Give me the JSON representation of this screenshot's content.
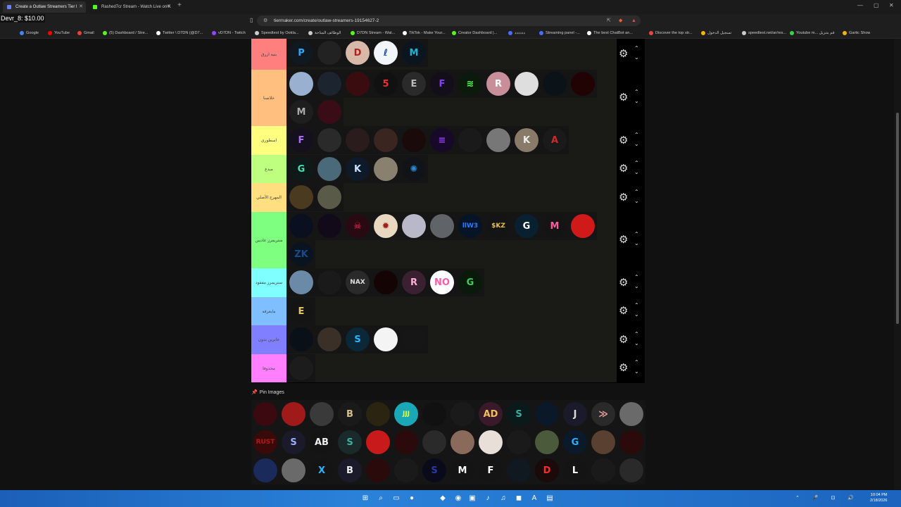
{
  "overlay": {
    "text": "Devr_8: $10.00"
  },
  "browser": {
    "tabs": [
      {
        "label": "Create a Outlaw Streamers Tier l",
        "active": true,
        "favicon_color": "#6b7dff"
      },
      {
        "label": "Rashed7cr Stream - Watch Live on K",
        "active": false,
        "favicon_color": "#53fc18"
      }
    ],
    "new_tab": "+",
    "window_controls": [
      "—",
      "▢",
      "✕"
    ],
    "url": "tiermaker.com/create/outlaw-streamers-19154627-2",
    "bookmarks": [
      {
        "label": "Google",
        "color": "#4285f4"
      },
      {
        "label": "YouTube",
        "color": "#ff0000"
      },
      {
        "label": "Gmail",
        "color": "#ea4335"
      },
      {
        "label": "(5) Dashboard / Stre...",
        "color": "#53fc18"
      },
      {
        "label": "Twitter \\ D7DN (@D7...",
        "color": "#ffffff"
      },
      {
        "label": "vD7DN - Twitch",
        "color": "#9146ff"
      },
      {
        "label": "Speedtest by Ookla...",
        "color": "#cccccc"
      },
      {
        "label": "الوظائف المتاحة",
        "color": "#cccccc"
      },
      {
        "label": "D7DN Stream - Wat...",
        "color": "#53fc18"
      },
      {
        "label": "TikTok - Make Your...",
        "color": "#ffffff"
      },
      {
        "label": "Creator Dashboard |...",
        "color": "#53fc18"
      },
      {
        "label": "دددددد",
        "color": "#4b6bff"
      },
      {
        "label": "Streaming panel -...",
        "color": "#4b6bff"
      },
      {
        "label": "The best ChatBot an...",
        "color": "#ffffff"
      },
      {
        "label": "Discover the top str...",
        "color": "#e84545"
      },
      {
        "label": "تسجيل الدخول",
        "color": "#f5b400"
      },
      {
        "label": "speedtest.net/ar/res...",
        "color": "#cccccc"
      },
      {
        "label": "Youtube m... قم بتنزيل",
        "color": "#3ecf4a"
      },
      {
        "label": "Gartic Show",
        "color": "#f5b400"
      }
    ]
  },
  "tiers": [
    {
      "label": "بنيه ازرق",
      "color": "#ff7f7f",
      "items": [
        {
          "glyph": "P",
          "bg": "#101820",
          "fg": "#2ea8ff"
        },
        {
          "glyph": "",
          "bg": "#222",
          "fg": "#888"
        },
        {
          "glyph": "D",
          "bg": "#d8b8a8",
          "fg": "#b0201c"
        },
        {
          "glyph": "ℓ",
          "bg": "#f2f6fa",
          "fg": "#1a4aa8"
        },
        {
          "glyph": "M",
          "bg": "#0a1520",
          "fg": "#19b3d4"
        }
      ]
    },
    {
      "label": "خلاصنا",
      "color": "#ffbf7f",
      "items": [
        {
          "glyph": "",
          "bg": "#9ab0d0",
          "fg": "#fff"
        },
        {
          "glyph": "",
          "bg": "#1c2430",
          "fg": "#555"
        },
        {
          "glyph": "",
          "bg": "#3a0c10",
          "fg": "#c01a1a"
        },
        {
          "glyph": "5",
          "bg": "#111",
          "fg": "#ff2b2b"
        },
        {
          "glyph": "E",
          "bg": "#2a2a2a",
          "fg": "#bbb"
        },
        {
          "glyph": "F",
          "bg": "#120f1a",
          "fg": "#8a3cff"
        },
        {
          "glyph": "≋",
          "bg": "#0b1a0b",
          "fg": "#55ff55"
        },
        {
          "glyph": "R",
          "bg": "#c88e9a",
          "fg": "#fff"
        },
        {
          "glyph": "",
          "bg": "#dedede",
          "fg": "#222"
        },
        {
          "glyph": "",
          "bg": "#0b1218",
          "fg": "#29b6d8"
        },
        {
          "glyph": "",
          "bg": "#220303",
          "fg": "#d01a1a"
        },
        {
          "glyph": "M",
          "bg": "#1e1e1e",
          "fg": "#aaa"
        },
        {
          "glyph": "",
          "bg": "#3a0c16",
          "fg": "#c02050"
        }
      ]
    },
    {
      "label": "اسطوري",
      "color": "#ffff7f",
      "items": [
        {
          "glyph": "F",
          "bg": "#14101e",
          "fg": "#b070ff"
        },
        {
          "glyph": "",
          "bg": "#2a2a2a",
          "fg": "#ddd"
        },
        {
          "glyph": "",
          "bg": "#2a1c1c",
          "fg": "#c44"
        },
        {
          "glyph": "",
          "bg": "#3a2520",
          "fg": "#caa"
        },
        {
          "glyph": "",
          "bg": "#1a0a0a",
          "fg": "#d33"
        },
        {
          "glyph": "≡",
          "bg": "#18082a",
          "fg": "#9a3cff"
        },
        {
          "glyph": "",
          "bg": "#1a1a1a",
          "fg": "#999"
        },
        {
          "glyph": "",
          "bg": "#777",
          "fg": "#eee"
        },
        {
          "glyph": "K",
          "bg": "#8a7a68",
          "fg": "#eee"
        },
        {
          "glyph": "A",
          "bg": "#1a1a1a",
          "fg": "#d02a2a"
        }
      ]
    },
    {
      "label": "مبدع",
      "color": "#bfff7f",
      "items": [
        {
          "glyph": "G",
          "bg": "#0d1a17",
          "fg": "#3fe0b0"
        },
        {
          "glyph": "",
          "bg": "#4a6a7a",
          "fg": "#eee"
        },
        {
          "glyph": "K",
          "bg": "#0e1a2a",
          "fg": "#cfe0ff"
        },
        {
          "glyph": "",
          "bg": "#8a8070",
          "fg": "#eee"
        },
        {
          "glyph": "✺",
          "bg": "#101418",
          "fg": "#2a8ad8"
        }
      ]
    },
    {
      "label": "المهرج الأصلي",
      "color": "#ffdf7f",
      "items": [
        {
          "glyph": "",
          "bg": "#4a3a20",
          "fg": "#d8b050"
        },
        {
          "glyph": "",
          "bg": "#5a5a48",
          "fg": "#ddd"
        }
      ]
    },
    {
      "label": "ستريمرز عاديين",
      "color": "#7fff7f",
      "items": [
        {
          "glyph": "",
          "bg": "#0a1020",
          "fg": "#2a6ad8"
        },
        {
          "glyph": "",
          "bg": "#120a18",
          "fg": "#c060ff"
        },
        {
          "glyph": "☠",
          "bg": "#2a0a12",
          "fg": "#ff2a5a"
        },
        {
          "glyph": "✹",
          "bg": "#e8d8c0",
          "fg": "#a0201a"
        },
        {
          "glyph": "",
          "bg": "#b8b8c8",
          "fg": "#333"
        },
        {
          "glyph": "",
          "bg": "#606468",
          "fg": "#ccc"
        },
        {
          "glyph": "llW3",
          "bg": "#061428",
          "fg": "#2a7aff"
        },
        {
          "glyph": "$KZ",
          "bg": "#141414",
          "fg": "#e8c040"
        },
        {
          "glyph": "G",
          "bg": "#082030",
          "fg": "#fff"
        },
        {
          "glyph": "M",
          "bg": "#141414",
          "fg": "#ff5aa0"
        },
        {
          "glyph": "",
          "bg": "#d01a1a",
          "fg": "#111"
        },
        {
          "glyph": "ZK",
          "bg": "#0a1420",
          "fg": "#1a4a8a"
        }
      ]
    },
    {
      "label": "ستريمرز مفقود",
      "color": "#7fffff",
      "items": [
        {
          "glyph": "",
          "bg": "#6a8aa8",
          "fg": "#eee"
        },
        {
          "glyph": "",
          "bg": "#1a1a1a",
          "fg": "#777"
        },
        {
          "glyph": "NAX",
          "bg": "#2a2a2a",
          "fg": "#ddd"
        },
        {
          "glyph": "",
          "bg": "#140404",
          "fg": "#e01a1a"
        },
        {
          "glyph": "R",
          "bg": "#3a2030",
          "fg": "#ffb0d8"
        },
        {
          "glyph": "NO",
          "bg": "#ffffff",
          "fg": "#ff5aa8"
        },
        {
          "glyph": "G",
          "bg": "#0a1a0a",
          "fg": "#3acf5a"
        }
      ]
    },
    {
      "label": "مايعرفه",
      "color": "#7fbfff",
      "items": [
        {
          "glyph": "E",
          "bg": "#141414",
          "fg": "#e8c860"
        }
      ]
    },
    {
      "label": "عابرين بدون",
      "color": "#7f7fff",
      "items": [
        {
          "glyph": "",
          "bg": "#0a1018",
          "fg": "#1a4a8a"
        },
        {
          "glyph": "",
          "bg": "#3a3028",
          "fg": "#ddd"
        },
        {
          "glyph": "S",
          "bg": "#0a2838",
          "fg": "#2ab4ff"
        },
        {
          "glyph": "",
          "bg": "#f4f4f4",
          "fg": "#1a2a6a"
        },
        {
          "glyph": "",
          "bg": "#161616",
          "fg": "#444"
        }
      ]
    },
    {
      "label": "محذوفا",
      "color": "#ff7fff",
      "items": [
        {
          "glyph": "",
          "bg": "#1c1c1c",
          "fg": "#555"
        }
      ]
    }
  ],
  "pin_images": {
    "title": "Pin Images",
    "items": [
      {
        "glyph": "",
        "bg": "#3a0a10",
        "fg": "#ff2a3a"
      },
      {
        "glyph": "",
        "bg": "#a01a1a",
        "fg": "#111"
      },
      {
        "glyph": "",
        "bg": "#3a3a3a",
        "fg": "#ccc"
      },
      {
        "glyph": "B",
        "bg": "#1a1a1a",
        "fg": "#d8c08a"
      },
      {
        "glyph": "",
        "bg": "#2a2410",
        "fg": "#e8d040"
      },
      {
        "glyph": "JJJ",
        "bg": "#1aa8b8",
        "fg": "#e8ff3a"
      },
      {
        "glyph": "",
        "bg": "#111",
        "fg": "#777"
      },
      {
        "glyph": "",
        "bg": "#1a1a1a",
        "fg": "#d02a2a"
      },
      {
        "glyph": "AD",
        "bg": "#3a1a2a",
        "fg": "#f0c060"
      },
      {
        "glyph": "S",
        "bg": "#0a1a1a",
        "fg": "#3ab0a0"
      },
      {
        "glyph": "",
        "bg": "#0a1828",
        "fg": "#1a6ad8"
      },
      {
        "glyph": "J",
        "bg": "#1a1a2a",
        "fg": "#ddd"
      },
      {
        "glyph": "≫",
        "bg": "#2a2a2a",
        "fg": "#e8a0a0"
      },
      {
        "glyph": "",
        "bg": "#6a6a6a",
        "fg": "#eee"
      },
      {
        "glyph": "RUST",
        "bg": "#3a0a0a",
        "fg": "#b01a1a"
      },
      {
        "glyph": "S",
        "bg": "#1a1a2a",
        "fg": "#9ab0ff"
      },
      {
        "glyph": "AB",
        "bg": "#141414",
        "fg": "#eee"
      },
      {
        "glyph": "S",
        "bg": "#1a2a2a",
        "fg": "#3ab0a0"
      },
      {
        "glyph": "",
        "bg": "#c81a1a",
        "fg": "#111"
      },
      {
        "glyph": "",
        "bg": "#2a0a0a",
        "fg": "#d02a2a"
      },
      {
        "glyph": "",
        "bg": "#2a2a2a",
        "fg": "#ccc"
      },
      {
        "glyph": "",
        "bg": "#8a6a5a",
        "fg": "#eee"
      },
      {
        "glyph": "",
        "bg": "#e8e0d8",
        "fg": "#333"
      },
      {
        "glyph": "",
        "bg": "#1a1a1a",
        "fg": "#eee"
      },
      {
        "glyph": "",
        "bg": "#4a5a3a",
        "fg": "#eee"
      },
      {
        "glyph": "G",
        "bg": "#0a1a2a",
        "fg": "#2ab0ff"
      },
      {
        "glyph": "",
        "bg": "#5a4030",
        "fg": "#eee"
      },
      {
        "glyph": "",
        "bg": "#2a0a0a",
        "fg": "#ff6a2a"
      },
      {
        "glyph": "",
        "bg": "#1a2a5a",
        "fg": "#8ab0ff"
      },
      {
        "glyph": "",
        "bg": "#6a6a6a",
        "fg": "#eee"
      },
      {
        "glyph": "X",
        "bg": "#141414",
        "fg": "#2ab4ff"
      },
      {
        "glyph": "B",
        "bg": "#1a1a2a",
        "fg": "#eee"
      },
      {
        "glyph": "",
        "bg": "#2a0a0a",
        "fg": "#ff2a3a"
      },
      {
        "glyph": "",
        "bg": "#1a1a1a",
        "fg": "#ddd"
      },
      {
        "glyph": "S",
        "bg": "#0a0a1a",
        "fg": "#2a3aa8"
      },
      {
        "glyph": "M",
        "bg": "#141414",
        "fg": "#fff"
      },
      {
        "glyph": "F",
        "bg": "#141414",
        "fg": "#fff"
      },
      {
        "glyph": "",
        "bg": "#101820",
        "fg": "#9ab0d0"
      },
      {
        "glyph": "D",
        "bg": "#1a0a0a",
        "fg": "#ff2a2a"
      },
      {
        "glyph": "L",
        "bg": "#141414",
        "fg": "#fff"
      },
      {
        "glyph": "",
        "bg": "#1a1a1a",
        "fg": "#aaa"
      },
      {
        "glyph": "",
        "bg": "#2a2a2a",
        "fg": "#888"
      }
    ]
  },
  "controls": {
    "gear": "⚙",
    "up": "⌃",
    "down": "⌄"
  },
  "taskbar": {
    "icons": [
      "⊞",
      "⌕",
      "▭",
      "●",
      "◆",
      "◉",
      "▣",
      "♪",
      "♫",
      "◼",
      "A",
      "▤",
      "◎"
    ],
    "tray": "⌃ 🎤 ⊡ 🔊",
    "time": "10:04 PM",
    "date": "2/18/2026"
  }
}
